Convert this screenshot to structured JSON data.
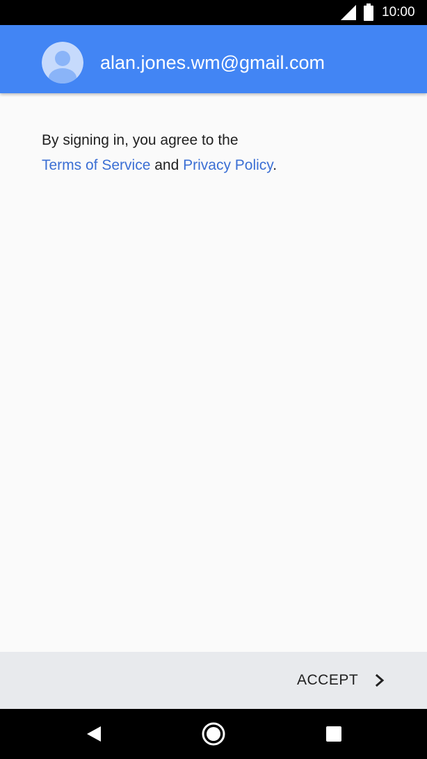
{
  "status_bar": {
    "time": "10:00",
    "icons": [
      "cell-signal-icon",
      "battery-icon"
    ]
  },
  "account": {
    "email": "alan.jones.wm@gmail.com",
    "avatar_icon": "account-avatar-icon"
  },
  "agreement": {
    "intro": "By signing in, you agree to the",
    "terms_link": "Terms of Service",
    "conjunction": " and ",
    "privacy_link": "Privacy Policy",
    "end": "."
  },
  "footer": {
    "accept_label": "ACCEPT",
    "accept_icon": "chevron-right-icon"
  },
  "nav_bar": {
    "icons": [
      "back-icon",
      "home-icon",
      "recents-icon"
    ]
  },
  "colors": {
    "header": "#4285f4",
    "link": "#3b6fd4",
    "background": "#fafafa",
    "footer": "#e8eaed"
  }
}
